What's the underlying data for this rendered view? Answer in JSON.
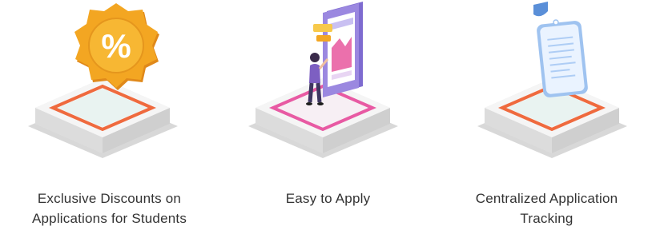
{
  "features": [
    {
      "icon": "discount-badge-icon",
      "caption_lines": [
        "Exclusive Discounts on",
        "Applications for Students"
      ],
      "ring_color": "#ef6a3e"
    },
    {
      "icon": "mobile-apply-icon",
      "caption_lines": [
        "Easy to Apply"
      ],
      "ring_color": "#e85aa3"
    },
    {
      "icon": "document-tracking-icon",
      "caption_lines": [
        "Centralized Application",
        "Tracking"
      ],
      "ring_color": "#ef6a3e"
    }
  ],
  "colors": {
    "badge_orange": "#f3a622",
    "phone_purple": "#9b88e0",
    "pink_accent": "#e8579e",
    "document_blue": "#aecdf5",
    "text": "#333333"
  }
}
